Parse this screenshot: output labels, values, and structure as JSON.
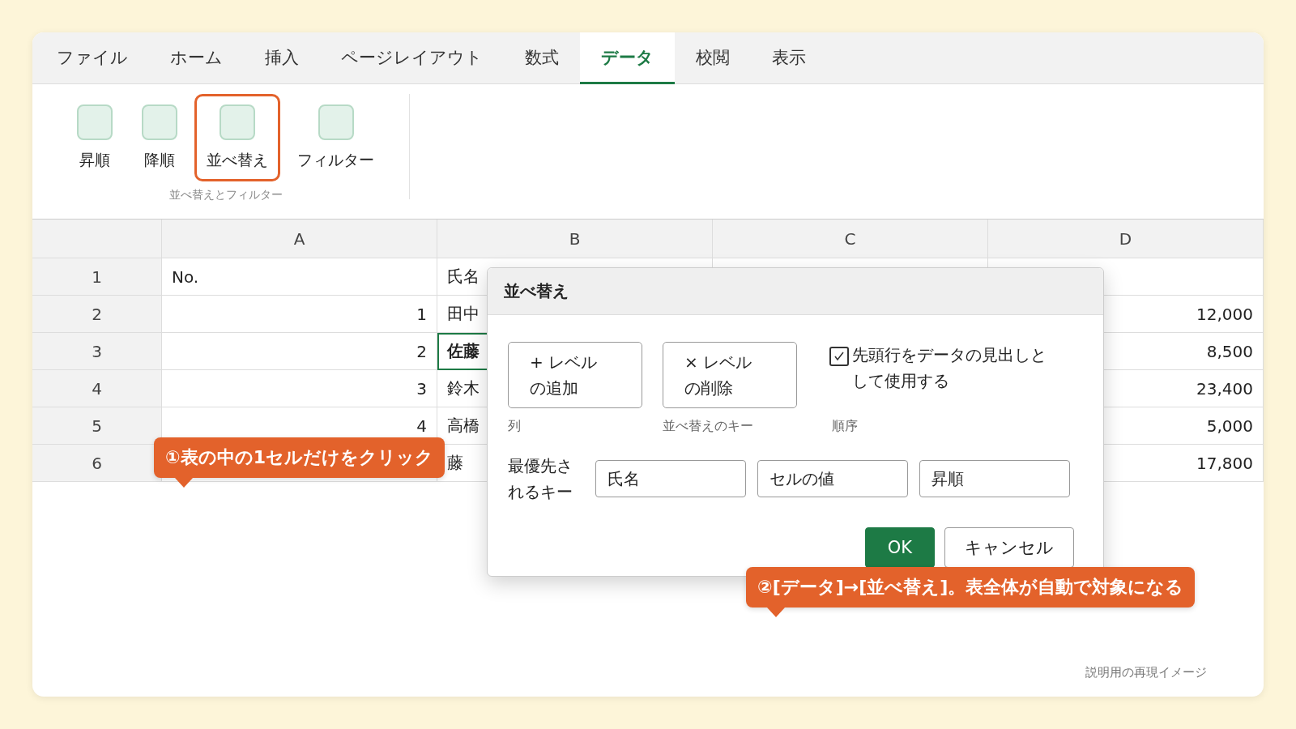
{
  "tabs": [
    {
      "label": "ファイル",
      "selected": false
    },
    {
      "label": "ホーム",
      "selected": false
    },
    {
      "label": "挿入",
      "selected": false
    },
    {
      "label": "ページレイアウト",
      "selected": false
    },
    {
      "label": "数式",
      "selected": false
    },
    {
      "label": "データ",
      "selected": true
    },
    {
      "label": "校閲",
      "selected": false
    },
    {
      "label": "表示",
      "selected": false
    }
  ],
  "ribbon": {
    "buttons": [
      {
        "label": "昇順",
        "highlighted": false
      },
      {
        "label": "降順",
        "highlighted": false
      },
      {
        "label": "並べ替え",
        "highlighted": true
      },
      {
        "label": "フィルター",
        "highlighted": false
      }
    ],
    "group_label": "並べ替えとフィルター"
  },
  "sheet": {
    "columns": [
      "A",
      "B",
      "C",
      "D"
    ],
    "rows": [
      {
        "number": "1",
        "kind": "header",
        "a": "No.",
        "b": "氏名",
        "selected": false
      },
      {
        "number": "2",
        "kind": "data",
        "a": "1",
        "b": "田中",
        "d": "12,000",
        "selected": false
      },
      {
        "number": "3",
        "kind": "data",
        "a": "2",
        "b": "佐藤",
        "d": "8,500",
        "selected": true
      },
      {
        "number": "4",
        "kind": "data",
        "a": "3",
        "b": "鈴木",
        "d": "23,400",
        "selected": false
      },
      {
        "number": "5",
        "kind": "data",
        "a": "4",
        "b": "高橋",
        "d": "5,000",
        "selected": false
      },
      {
        "number": "6",
        "kind": "data",
        "b": "藤",
        "d": "17,800",
        "selected": false
      }
    ]
  },
  "dialog": {
    "title": "並べ替え",
    "level_buttons": [
      {
        "symbol": "+",
        "label": "レベルの追加"
      },
      {
        "symbol": "×",
        "label": "レベルの削除"
      }
    ],
    "header_checkbox": {
      "checked": true,
      "label": "先頭行をデータの見出しとして使用する"
    },
    "column_labels": [
      "列",
      "並べ替えのキー",
      "順序"
    ],
    "key_row": {
      "label": "最優先されるキー",
      "fields": [
        "氏名",
        "セルの値",
        "昇順"
      ]
    },
    "actions": [
      {
        "label": "OK",
        "kind": "primary"
      },
      {
        "label": "キャンセル",
        "kind": "secondary"
      }
    ]
  },
  "callouts": [
    {
      "text": "①表の中の1セルだけをクリック"
    },
    {
      "text": "②[データ]→[並べ替え]。表全体が自動で対象になる"
    }
  ],
  "footnote": "説明用の再現イメージ"
}
